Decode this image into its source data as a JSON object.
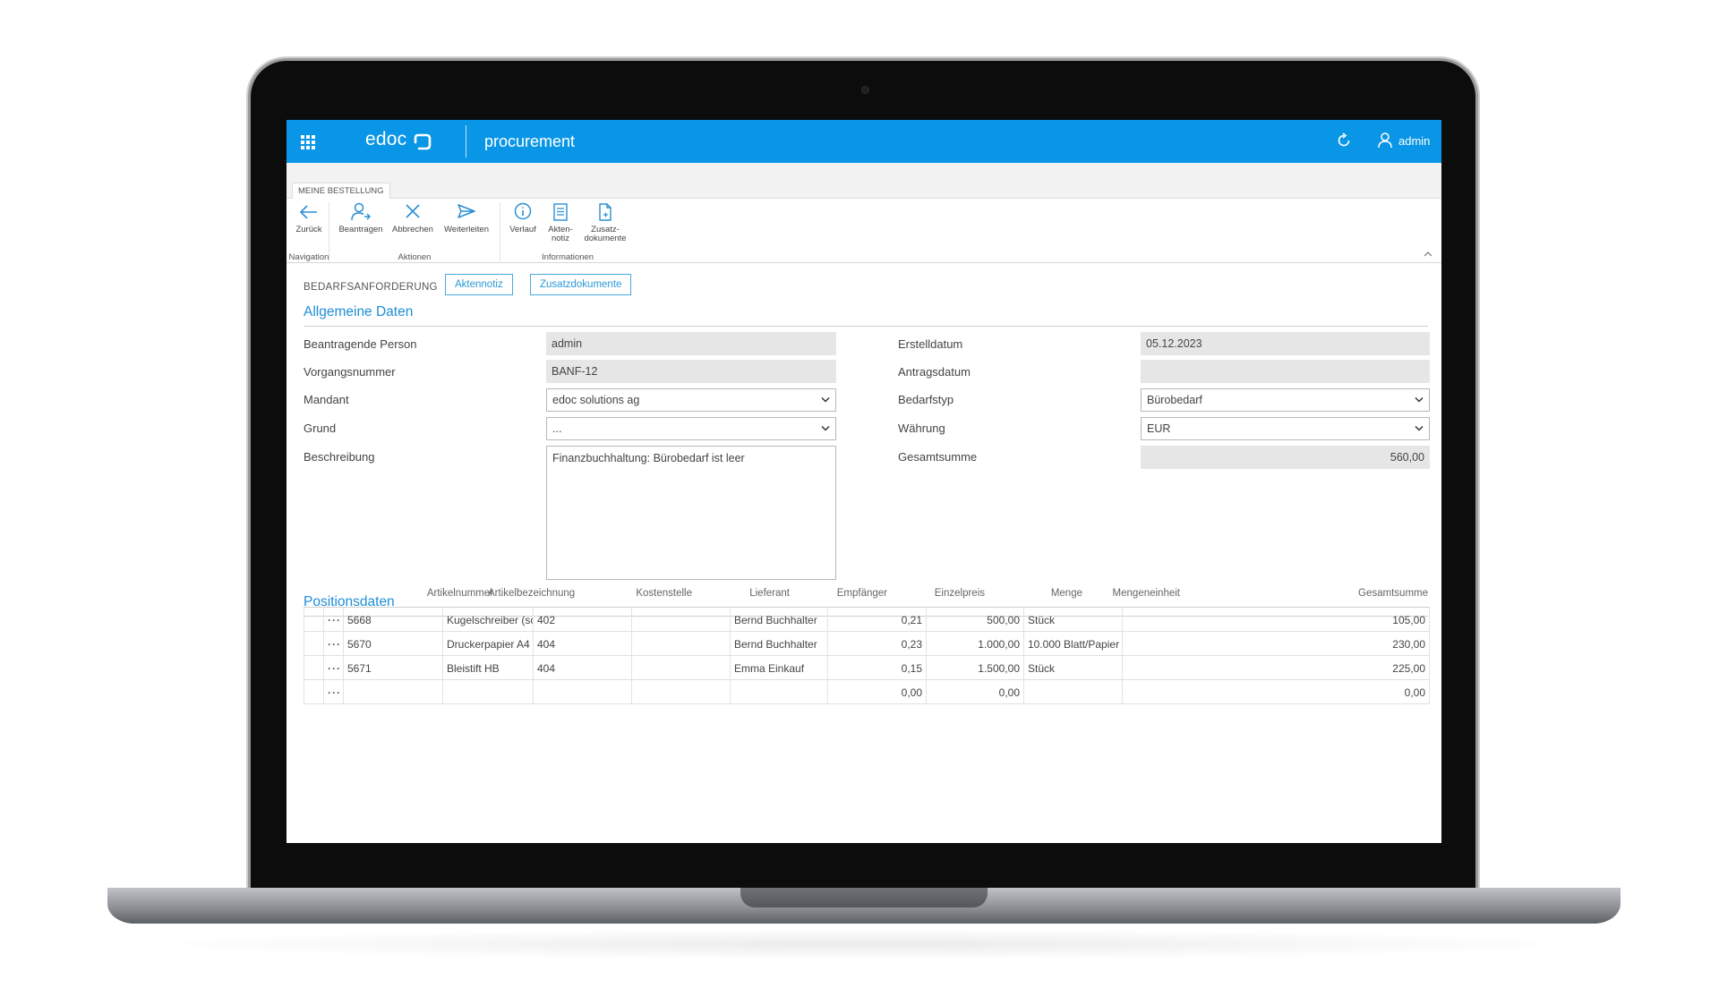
{
  "app": {
    "logo_text": "edoc",
    "name": "procurement",
    "user": "admin",
    "accent": "#0a96e6"
  },
  "ribbon": {
    "tab": "MEINE BESTELLUNG",
    "buttons": {
      "back": "Zurück",
      "apply": "Beantragen",
      "cancel": "Abbrechen",
      "forward": "Weiterleiten",
      "history": "Verlauf",
      "note_1": "Akten-",
      "note_2": "notiz",
      "docs_1": "Zusatz-",
      "docs_2": "dokumente"
    },
    "groups": {
      "navigation": "Navigation",
      "actions": "Aktionen",
      "info": "Informationen"
    }
  },
  "form": {
    "type": "BEDARFSANFORDERUNG",
    "link_note": "Aktennotiz",
    "link_docs": "Zusatzdokumente",
    "section_general": "Allgemeine Daten",
    "section_positions": "Positionsdaten",
    "labels": {
      "person": "Beantragende Person",
      "number": "Vorgangsnummer",
      "client": "Mandant",
      "reason": "Grund",
      "description": "Beschreibung",
      "created": "Erstelldatum",
      "request_date": "Antragsdatum",
      "demand_type": "Bedarfstyp",
      "currency": "Währung",
      "total": "Gesamtsumme"
    },
    "values": {
      "person": "admin",
      "number": "BANF-12",
      "client": "edoc solutions ag",
      "reason": "...",
      "description": "Finanzbuchhaltung: Bürobedarf ist leer",
      "created": "05.12.2023",
      "request_date": "",
      "demand_type": "Bürobedarf",
      "currency": "EUR",
      "total": "560,00"
    }
  },
  "table": {
    "headers": {
      "article_no": "Artikelnummer",
      "article_name": "Artikelbezeichnung",
      "cost_center": "Kostenstelle",
      "supplier": "Lieferant",
      "recipient": "Empfänger",
      "unit_price": "Einzelpreis",
      "quantity": "Menge",
      "unit": "Mengeneinheit",
      "total": "Gesamtsumme"
    },
    "rows": [
      {
        "menu": "···",
        "no": "5668",
        "name": "Kugelschreiber (sc...",
        "cc": "402",
        "supplier": "",
        "recipient": "Bernd Buchhalter",
        "price": "0,21",
        "qty": "500,00",
        "unit": "Stück",
        "total": "105,00"
      },
      {
        "menu": "···",
        "no": "5670",
        "name": "Druckerpapier A4 ...",
        "cc": "404",
        "supplier": "",
        "recipient": "Bernd Buchhalter",
        "price": "0,23",
        "qty": "1.000,00",
        "unit": "10.000 Blatt/Papier",
        "total": "230,00"
      },
      {
        "menu": "···",
        "no": "5671",
        "name": "Bleistift HB",
        "cc": "404",
        "supplier": "",
        "recipient": "Emma Einkauf",
        "price": "0,15",
        "qty": "1.500,00",
        "unit": "Stück",
        "total": "225,00"
      },
      {
        "menu": "···",
        "no": "",
        "name": "",
        "cc": "",
        "supplier": "",
        "recipient": "",
        "price": "0,00",
        "qty": "0,00",
        "unit": "",
        "total": "0,00"
      }
    ]
  }
}
